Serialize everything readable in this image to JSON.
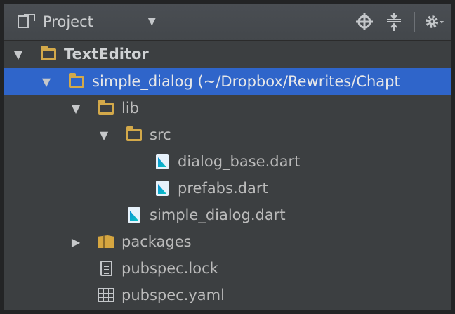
{
  "panel": {
    "title": "Project",
    "dropdown_icon": "caret-down-icon",
    "tools": [
      "crosshair-icon",
      "collapse-icon",
      "gear-icon"
    ]
  },
  "tree": [
    {
      "label": "TextEditor",
      "icon": "project-folder-icon",
      "expanded": true,
      "bold": true
    },
    {
      "label": "simple_dialog (~/Dropbox/Rewrites/Chapt",
      "icon": "folder-icon",
      "expanded": true,
      "selected": true
    },
    {
      "label": "lib",
      "icon": "folder-icon",
      "expanded": true
    },
    {
      "label": "src",
      "icon": "folder-icon",
      "expanded": true
    },
    {
      "label": "dialog_base.dart",
      "icon": "dart-file-icon"
    },
    {
      "label": "prefabs.dart",
      "icon": "dart-file-icon"
    },
    {
      "label": "simple_dialog.dart",
      "icon": "dart-file-icon"
    },
    {
      "label": "packages",
      "icon": "package-icon",
      "expanded": false
    },
    {
      "label": "pubspec.lock",
      "icon": "text-file-icon"
    },
    {
      "label": "pubspec.yaml",
      "icon": "yaml-file-icon"
    }
  ],
  "colors": {
    "selection": "#2f65ca",
    "background": "#3c3f41",
    "folder": "#d3a94a"
  }
}
